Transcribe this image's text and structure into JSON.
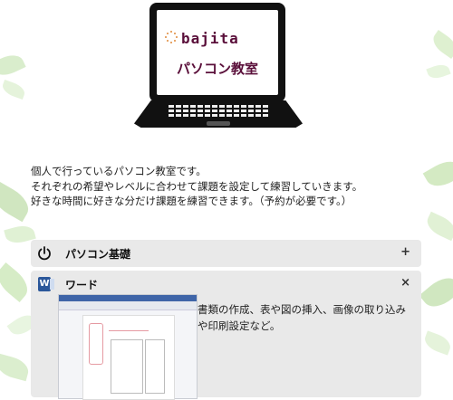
{
  "brand": {
    "name": "bajita",
    "subtitle": "パソコン教室"
  },
  "intro": [
    "個人で行っているパソコン教室です。",
    "それぞれの希望やレベルに合わせて課題を設定して練習していきます。",
    "好きな時間に好きな分だけ課題を練習できます。（予約が必要です。）"
  ],
  "accordion": [
    {
      "title": "パソコン基礎",
      "toggle": "+",
      "icon": "power-icon",
      "expanded": false
    },
    {
      "title": "ワード",
      "toggle": "×",
      "icon": "word-icon",
      "expanded": true,
      "description": "書類の作成、表や図の挿入、画像の取り込みや印刷設定など。"
    }
  ],
  "colors": {
    "brand": "#5a0f3a",
    "accent": "#e0893a",
    "panel": "#e9e9e9",
    "word": "#2b579a"
  }
}
